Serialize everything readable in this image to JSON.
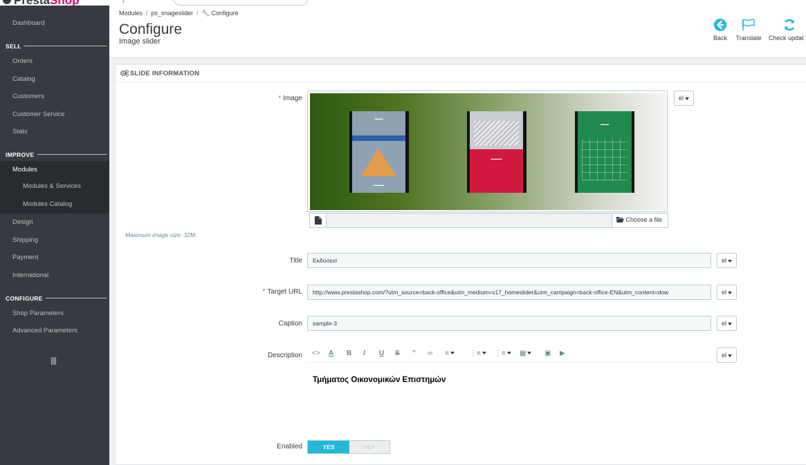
{
  "brand": {
    "name_dark": "Presta",
    "name_pink": "Shop"
  },
  "sidebar": {
    "items_top": [
      {
        "label": "Dashboard"
      }
    ],
    "sections": [
      {
        "title": "SELL",
        "items": [
          "Orders",
          "Catalog",
          "Customers",
          "Customer Service",
          "Stats"
        ]
      },
      {
        "title": "IMPROVE",
        "items": [
          "Modules",
          "Design",
          "Shipping",
          "Payment",
          "International"
        ],
        "submenu": [
          "Modules & Services",
          "Modules Catalog"
        ],
        "active": "Modules"
      },
      {
        "title": "CONFIGURE",
        "items": [
          "Shop Parameters",
          "Advanced Parameters"
        ]
      }
    ]
  },
  "header": {
    "breadcrumb": [
      "Modules",
      "ps_imageslider",
      "Configure"
    ],
    "title": "Configure",
    "subtitle": "Image slider",
    "toolbar": {
      "back": "Back",
      "translate": "Translate",
      "check_update": "Check updat"
    }
  },
  "panel": {
    "heading": "SLIDE INFORMATION",
    "image_label": "Image",
    "lang": "el",
    "choose_file": "Choose a file",
    "max_size_help": "Maximum image size: 32M.",
    "title_label": "Title",
    "title_value": "Εκδοσεισ",
    "url_label": "Target URL",
    "url_value": "http://www.prestashop.com/?utm_source=back-office&utm_medium=v17_homeslider&utm_campaign=back-office-EN&utm_content=dow",
    "caption_label": "Caption",
    "caption_value": "sample-3",
    "description_label": "Description",
    "description_text": "Τμήματος Οικονομικών Επιστημών",
    "enabled_label": "Enabled",
    "yes": "YES",
    "no": "NO"
  },
  "colors": {
    "accent": "#25b9d7",
    "sidebar": "#363a41",
    "required": "#c05c67",
    "brand_pink": "#df0067"
  }
}
